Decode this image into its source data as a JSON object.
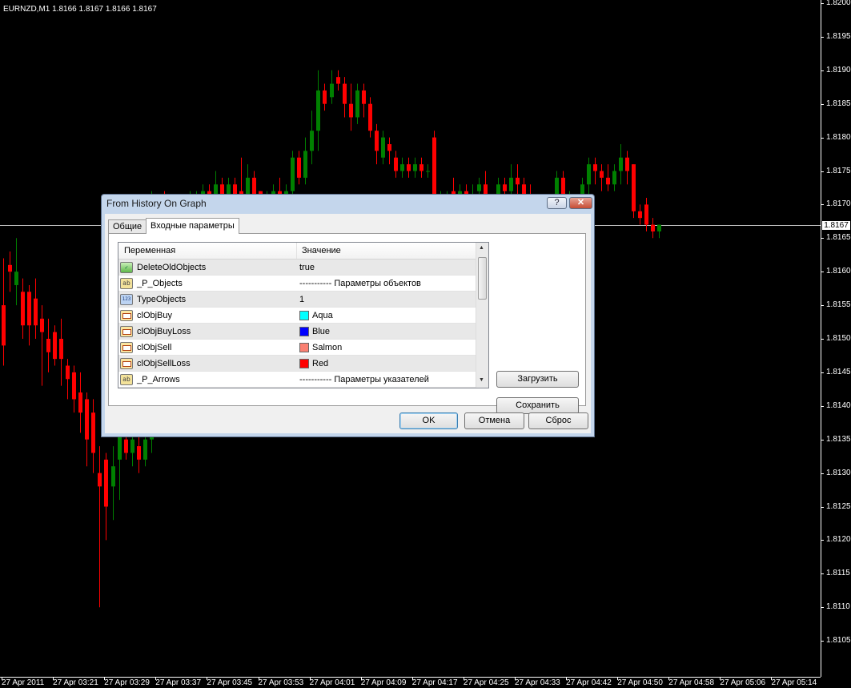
{
  "chart": {
    "title": "EURNZD,M1  1.8166 1.8167 1.8166 1.8167",
    "current_price": "1.8167",
    "price_labels": [
      "1.8200",
      "1.8195",
      "1.8190",
      "1.8185",
      "1.8180",
      "1.8175",
      "1.8170",
      "1.8165",
      "1.8160",
      "1.8155",
      "1.8150",
      "1.8145",
      "1.8140",
      "1.8135",
      "1.8130",
      "1.8125",
      "1.8120",
      "1.8115",
      "1.8110",
      "1.8105"
    ],
    "time_labels": [
      "27 Apr 2011",
      "27 Apr 03:21",
      "27 Apr 03:29",
      "27 Apr 03:37",
      "27 Apr 03:45",
      "27 Apr 03:53",
      "27 Apr 04:01",
      "27 Apr 04:09",
      "27 Apr 04:17",
      "27 Apr 04:25",
      "27 Apr 04:33",
      "27 Apr 04:42",
      "27 Apr 04:50",
      "27 Apr 04:58",
      "27 Apr 05:06",
      "27 Apr 05:14"
    ],
    "bull_color": "#008000",
    "bear_color": "#ff0000"
  },
  "chart_data": {
    "type": "candlestick",
    "symbol": "EURNZD",
    "timeframe": "M1",
    "ylim": [
      1.8103,
      1.82
    ],
    "candles": [
      [
        1.8155,
        1.8162,
        1.8146,
        1.8149
      ],
      [
        1.8161,
        1.8163,
        1.8157,
        1.816
      ],
      [
        1.8158,
        1.8165,
        1.8155,
        1.816
      ],
      [
        1.8157,
        1.8159,
        1.815,
        1.8152
      ],
      [
        1.8157,
        1.8158,
        1.8149,
        1.8152
      ],
      [
        1.8156,
        1.8159,
        1.815,
        1.8152
      ],
      [
        1.8153,
        1.8155,
        1.8143,
        1.8151
      ],
      [
        1.815,
        1.8153,
        1.8145,
        1.8148
      ],
      [
        1.8151,
        1.8152,
        1.8146,
        1.8147
      ],
      [
        1.815,
        1.8153,
        1.8143,
        1.8147
      ],
      [
        1.8146,
        1.8147,
        1.8141,
        1.8144
      ],
      [
        1.8145,
        1.8146,
        1.8139,
        1.8141
      ],
      [
        1.8142,
        1.8145,
        1.8136,
        1.8139
      ],
      [
        1.8141,
        1.8142,
        1.8131,
        1.8135
      ],
      [
        1.8139,
        1.8141,
        1.813,
        1.8133
      ],
      [
        1.813,
        1.8134,
        1.811,
        1.8128
      ],
      [
        1.8132,
        1.8133,
        1.812,
        1.8125
      ],
      [
        1.8128,
        1.8134,
        1.8123,
        1.8131
      ],
      [
        1.8132,
        1.8137,
        1.8126,
        1.8136
      ],
      [
        1.8135,
        1.8138,
        1.8132,
        1.8133
      ],
      [
        1.8133,
        1.8136,
        1.8131,
        1.8135
      ],
      [
        1.8134,
        1.8137,
        1.813,
        1.8132
      ],
      [
        1.8132,
        1.8136,
        1.8131,
        1.8135
      ],
      [
        1.8135,
        1.8172,
        1.8133,
        1.817
      ],
      [
        1.817,
        1.8171,
        1.8167,
        1.8169
      ],
      [
        1.8169,
        1.8172,
        1.8165,
        1.8167
      ],
      [
        1.8168,
        1.817,
        1.8166,
        1.8169
      ],
      [
        1.817,
        1.8171,
        1.8168,
        1.8169
      ],
      [
        1.8169,
        1.8171,
        1.8168,
        1.817
      ],
      [
        1.817,
        1.8172,
        1.8169,
        1.8171
      ],
      [
        1.817,
        1.8172,
        1.8169,
        1.8171
      ],
      [
        1.8171,
        1.8173,
        1.817,
        1.8172
      ],
      [
        1.8172,
        1.8173,
        1.8169,
        1.817
      ],
      [
        1.8171,
        1.8175,
        1.8169,
        1.8173
      ],
      [
        1.8173,
        1.8174,
        1.817,
        1.8171
      ],
      [
        1.817,
        1.8174,
        1.8168,
        1.8173
      ],
      [
        1.8173,
        1.8174,
        1.8169,
        1.8171
      ],
      [
        1.8172,
        1.8177,
        1.8168,
        1.817
      ],
      [
        1.8169,
        1.8176,
        1.8168,
        1.8174
      ],
      [
        1.8174,
        1.8175,
        1.817,
        1.8171
      ],
      [
        1.8172,
        1.8172,
        1.8168,
        1.8169
      ],
      [
        1.817,
        1.8172,
        1.8169,
        1.8171
      ],
      [
        1.8171,
        1.8173,
        1.817,
        1.8172
      ],
      [
        1.8172,
        1.8174,
        1.817,
        1.817
      ],
      [
        1.8171,
        1.8173,
        1.817,
        1.8172
      ],
      [
        1.8172,
        1.8178,
        1.8171,
        1.8177
      ],
      [
        1.8177,
        1.8178,
        1.8173,
        1.8174
      ],
      [
        1.8174,
        1.818,
        1.8173,
        1.8178
      ],
      [
        1.8178,
        1.8184,
        1.8176,
        1.8181
      ],
      [
        1.8181,
        1.819,
        1.8178,
        1.8187
      ],
      [
        1.8187,
        1.8188,
        1.8184,
        1.8185
      ],
      [
        1.8186,
        1.819,
        1.8185,
        1.8188
      ],
      [
        1.8189,
        1.819,
        1.8187,
        1.8188
      ],
      [
        1.8188,
        1.8189,
        1.8183,
        1.8185
      ],
      [
        1.8185,
        1.8188,
        1.8181,
        1.8183
      ],
      [
        1.8183,
        1.8188,
        1.8182,
        1.8187
      ],
      [
        1.8187,
        1.8188,
        1.8183,
        1.8185
      ],
      [
        1.8185,
        1.8186,
        1.818,
        1.8181
      ],
      [
        1.8181,
        1.8182,
        1.8176,
        1.8178
      ],
      [
        1.8177,
        1.8181,
        1.8176,
        1.818
      ],
      [
        1.8179,
        1.818,
        1.8176,
        1.8178
      ],
      [
        1.8177,
        1.8178,
        1.8174,
        1.8175
      ],
      [
        1.8175,
        1.8177,
        1.8174,
        1.8176
      ],
      [
        1.8176,
        1.8177,
        1.8174,
        1.8175
      ],
      [
        1.8175,
        1.8177,
        1.8174,
        1.8176
      ],
      [
        1.8176,
        1.8177,
        1.8174,
        1.8175
      ],
      [
        1.8175,
        1.8176,
        1.8174,
        1.8175
      ],
      [
        1.818,
        1.8181,
        1.8169,
        1.817
      ],
      [
        1.817,
        1.8172,
        1.8168,
        1.8171
      ],
      [
        1.8171,
        1.8172,
        1.817,
        1.8171
      ],
      [
        1.8172,
        1.8174,
        1.8168,
        1.8169
      ],
      [
        1.817,
        1.8173,
        1.8168,
        1.8172
      ],
      [
        1.8172,
        1.8173,
        1.8169,
        1.817
      ],
      [
        1.817,
        1.8173,
        1.8168,
        1.8171
      ],
      [
        1.8172,
        1.8174,
        1.817,
        1.8173
      ],
      [
        1.8173,
        1.8175,
        1.8166,
        1.8168
      ],
      [
        1.8169,
        1.8171,
        1.8168,
        1.817
      ],
      [
        1.817,
        1.8174,
        1.8169,
        1.8173
      ],
      [
        1.8173,
        1.8174,
        1.817,
        1.8172
      ],
      [
        1.8172,
        1.8176,
        1.8169,
        1.8174
      ],
      [
        1.8174,
        1.8176,
        1.8171,
        1.8173
      ],
      [
        1.8173,
        1.8174,
        1.8169,
        1.8171
      ],
      [
        1.8171,
        1.8173,
        1.8168,
        1.817
      ],
      [
        1.817,
        1.8171,
        1.8158,
        1.8163
      ],
      [
        1.8163,
        1.8169,
        1.8161,
        1.8168
      ],
      [
        1.8168,
        1.817,
        1.8165,
        1.8167
      ],
      [
        1.8166,
        1.8175,
        1.8165,
        1.8174
      ],
      [
        1.8174,
        1.8175,
        1.8168,
        1.8169
      ],
      [
        1.8169,
        1.8172,
        1.8168,
        1.817
      ],
      [
        1.8169,
        1.8171,
        1.8167,
        1.817
      ],
      [
        1.817,
        1.8174,
        1.8169,
        1.8173
      ],
      [
        1.8173,
        1.8177,
        1.817,
        1.8176
      ],
      [
        1.8176,
        1.8177,
        1.8173,
        1.8175
      ],
      [
        1.8175,
        1.8176,
        1.8172,
        1.8174
      ],
      [
        1.8174,
        1.8176,
        1.8172,
        1.8173
      ],
      [
        1.8173,
        1.8176,
        1.8172,
        1.8175
      ],
      [
        1.8175,
        1.8179,
        1.8173,
        1.8177
      ],
      [
        1.8177,
        1.8178,
        1.8173,
        1.8175
      ],
      [
        1.8176,
        1.8176,
        1.8168,
        1.8169
      ],
      [
        1.8169,
        1.817,
        1.8167,
        1.8168
      ],
      [
        1.817,
        1.8171,
        1.8166,
        1.8167
      ],
      [
        1.8167,
        1.8168,
        1.8165,
        1.8166
      ],
      [
        1.8166,
        1.8167,
        1.8165,
        1.8167
      ]
    ]
  },
  "dialog": {
    "title": "From History On Graph",
    "help_label": "?",
    "close_label": "✕",
    "tabs": [
      {
        "label": "Общие"
      },
      {
        "label": "Входные параметры"
      }
    ],
    "grid": {
      "col_variable": "Переменная",
      "col_value": "Значение",
      "rows": [
        {
          "icon": "bool",
          "icon_text": "✓",
          "name": "DeleteOldObjects",
          "value": "true"
        },
        {
          "icon": "str",
          "icon_text": "ab",
          "name": "_P_Objects",
          "value": "----------- Параметры объектов"
        },
        {
          "icon": "int",
          "icon_text": "123",
          "name": "TypeObjects",
          "value": "1"
        },
        {
          "icon": "color",
          "icon_text": "",
          "name": "clObjBuy",
          "value": "Aqua",
          "swatch": "#00ffff"
        },
        {
          "icon": "color",
          "icon_text": "",
          "name": "clObjBuyLoss",
          "value": "Blue",
          "swatch": "#0000ff"
        },
        {
          "icon": "color",
          "icon_text": "",
          "name": "clObjSell",
          "value": "Salmon",
          "swatch": "#fa8072"
        },
        {
          "icon": "color",
          "icon_text": "",
          "name": "clObjSellLoss",
          "value": "Red",
          "swatch": "#ff0000"
        },
        {
          "icon": "str",
          "icon_text": "ab",
          "name": "_P_Arrows",
          "value": "----------- Параметры указателей"
        }
      ]
    },
    "buttons": {
      "load": "Загрузить",
      "save": "Сохранить",
      "ok": "OK",
      "cancel": "Отмена",
      "reset": "Сброс"
    }
  }
}
